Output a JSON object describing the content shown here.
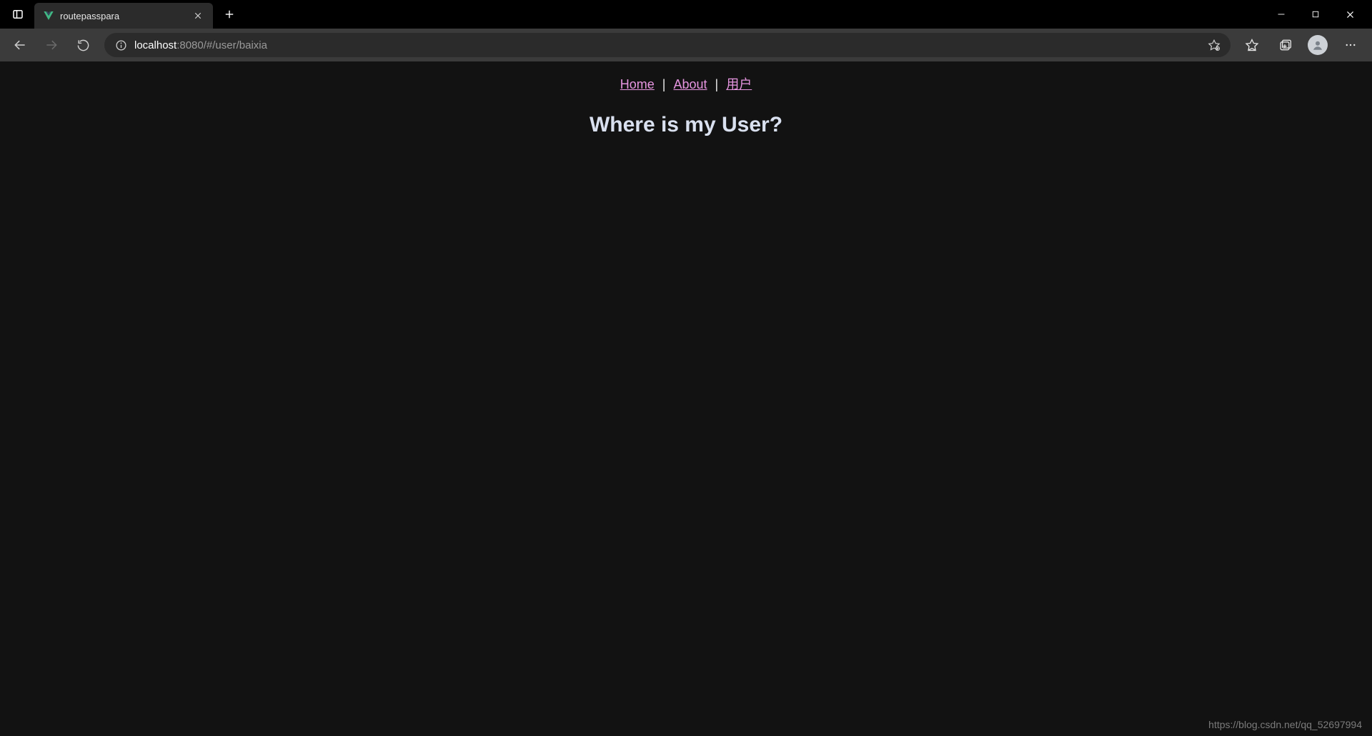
{
  "browser": {
    "tab_title": "routepasspara",
    "url_host": "localhost",
    "url_port_path": ":8080/#/user/baixia"
  },
  "page": {
    "nav": {
      "home": "Home",
      "about": "About",
      "user": "用户",
      "sep": " | "
    },
    "headline": "Where is my User?"
  },
  "watermark": "https://blog.csdn.net/qq_52697994"
}
